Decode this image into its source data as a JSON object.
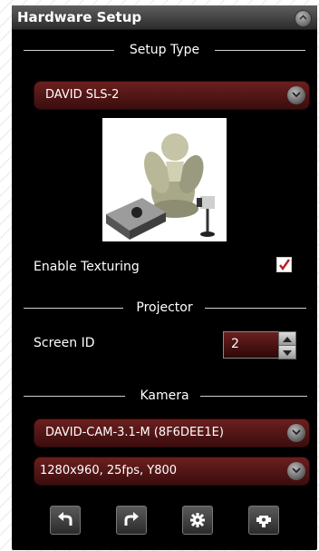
{
  "panel": {
    "title": "Hardware Setup"
  },
  "setup_type": {
    "section_label": "Setup Type",
    "selected": "DAVID SLS-2"
  },
  "texturing": {
    "label": "Enable Texturing",
    "checked": true,
    "check_mark": "✓"
  },
  "projector": {
    "section_label": "Projector",
    "screen_id_label": "Screen ID",
    "screen_id_value": "2"
  },
  "camera": {
    "section_label": "Kamera",
    "device_selected": "DAVID-CAM-3.1-M (8F6DEE1E)",
    "format_selected": "1280x960, 25fps, Y800"
  },
  "toolbar": {
    "icons": [
      "back-arrow-icon",
      "forward-arrow-icon",
      "settings-gear-icon",
      "camera-device-icon"
    ]
  },
  "colors": {
    "panel_bg": "#000000",
    "dropdown_red": "#6b1f1f",
    "text": "#ffffff"
  }
}
